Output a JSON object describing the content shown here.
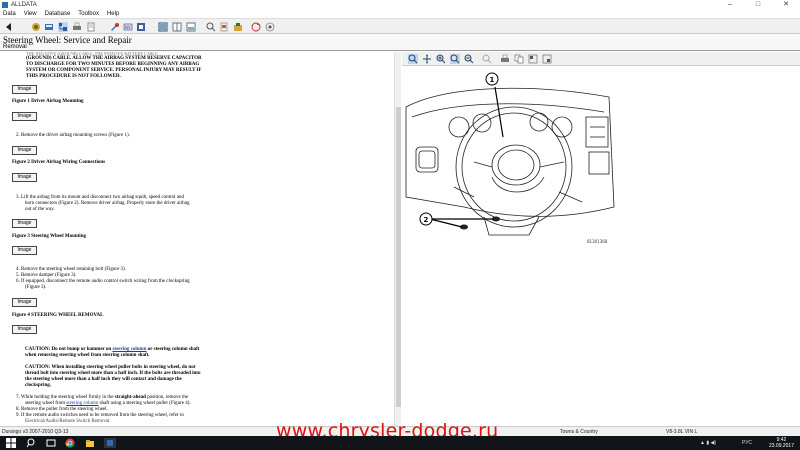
{
  "window": {
    "title": "ALLDATA",
    "minimize": "–",
    "maximize": "□",
    "close": "✕"
  },
  "menu": [
    "Data",
    "View",
    "Database",
    "Toolbox",
    "Help"
  ],
  "header": {
    "title": "Steering Wheel:  Service and Repair",
    "subtitle": "Removal"
  },
  "doc": {
    "warning_lines": [
      "(GROUND) CABLE. ALLOW THE AIRBAG SYSTEM RESERVE CAPACITOR",
      "TO DISCHARGE FOR TWO MINUTES BEFORE BEGINNING ANY AIRBAG",
      "SYSTEM OR COMPONENT SERVICE. PERSONAL INJURY MAY RESULT IF",
      "THIS PROCEDURE IS NOT FOLLOWED."
    ],
    "image_button": "Image",
    "fig1": "Figure 1 Driver Airbag Mounting",
    "step2": "2.  Remove the driver airbag mounting screws (Figure 1).",
    "fig2": "Figure 2 Driver Airbag Wiring Connections",
    "step3_lines": [
      "3.  Lift the airbag from its mount and disconnect two airbag squib, speed control and",
      "horn connectors (Figure 2). Remove driver airbag. Properly store the driver airbag",
      "out of the way."
    ],
    "fig3": "Figure 3 Steering Wheel Mounting",
    "step4": "4.  Remove the steering wheel retaining bolt (Figure 3).",
    "step5": "5.  Remove damper (Figure 3).",
    "step6_lines": [
      "6.  If equipped, disconnect the remote audio control switch wiring from the clockspring",
      "(Figure 3)."
    ],
    "fig4": "Figure 4 STEERING WHEEL REMOVAL",
    "caution1_pre": "CAUTION: Do not bump or hammer on ",
    "caution1_link": "steering column",
    "caution1_post": " or steering column shaft",
    "caution1_line2": "when removing steering wheel from steering column shaft.",
    "caution2_lines": [
      "CAUTION: When installing steering wheel puller bolts in steering wheel, do not",
      "thread bolt into steering wheel more than a half inch. If the bolts are threaded into",
      "the steering wheel more than a half inch they will contact and damage the",
      "clockspring."
    ],
    "step7_a": "7.  While holding the steering wheel firmly in the ",
    "step7_b": "straight-ahead",
    "step7_c": " position, remove the",
    "step7_line2_pre": "steering wheel from ",
    "step7_line2_link": "steering column",
    "step7_line2_post": " shaft using a steering wheel puller (Figure 4).",
    "step8": "8.  Remove the puller from the steering wheel.",
    "step9": "9.  If the remote audio switches need to be removed from the steering wheel, refer to",
    "step9_cut": "Electrical/Audio/Remote Switch Removal"
  },
  "figure": {
    "callout1": "1",
    "callout2": "2",
    "ref": "81301368"
  },
  "status": {
    "left": "Durango 4X4 V8-4.7L (2004)",
    "copyright": "Durango v3 2007-2010 Q3-13",
    "region": "Towns & Country",
    "engine": "V8-3.8L VIN L"
  },
  "watermark": "www.chrysler-dodge.ru",
  "taskbar": {
    "time": "9:42",
    "date": "23.09.2017",
    "lang": "РУС"
  },
  "colors": {
    "accent": "#2b6cb0",
    "watermark": "#e01010",
    "taskbar": "#101418"
  }
}
